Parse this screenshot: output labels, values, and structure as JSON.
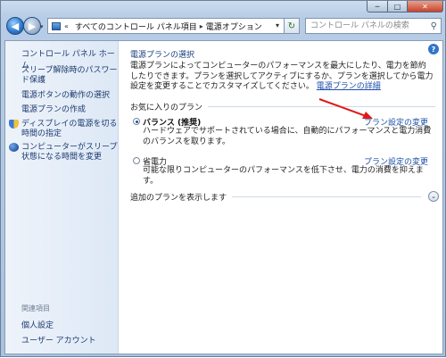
{
  "window": {
    "controls": {
      "minimize": "─",
      "maximize": "□",
      "close": "✕"
    }
  },
  "nav": {
    "back_glyph": "◀",
    "forward_glyph": "▶",
    "history_glyph": "▾",
    "address": {
      "overflow": "«",
      "segments": [
        "すべてのコントロール パネル項目",
        "電源オプション"
      ],
      "separator": "▸",
      "dropdown_glyph": "▾"
    },
    "refresh_glyph": "↻",
    "search_placeholder": "コントロール パネルの検索",
    "search_icon_glyph": "⚲"
  },
  "sidebar": {
    "home": "コントロール パネル ホーム",
    "links": [
      "スリープ解除時のパスワード保護",
      "電源ボタンの動作の選択",
      "電源プランの作成",
      "ディスプレイの電源を切る時間の指定",
      "コンピューターがスリープ状態になる時間を変更"
    ],
    "related_heading": "関連項目",
    "related_links": [
      "個人設定",
      "ユーザー アカウント"
    ]
  },
  "main": {
    "help_glyph": "?",
    "title": "電源プランの選択",
    "description": "電源プランによってコンピューターのパフォーマンスを最大にしたり、電力を節約したりできます。プランを選択してアクティブにするか、プランを選択してから電力設定を変更することでカスタマイズしてください。",
    "details_link": "電源プランの詳細",
    "favorites_heading": "お気に入りのプラン",
    "plans": [
      {
        "name": "バランス (推奨)",
        "selected": true,
        "description": "ハードウェアでサポートされている場合に、自動的にパフォーマンスと電力消費のバランスを取ります。",
        "change_link": "プラン設定の変更"
      },
      {
        "name": "省電力",
        "selected": false,
        "description": "可能な限りコンピューターのパフォーマンスを低下させ、電力の消費を抑えます。",
        "change_link": "プラン設定の変更"
      }
    ],
    "more_plans": "追加のプランを表示します",
    "more_plans_glyph": "⌄"
  },
  "colors": {
    "link": "#1c4ea8",
    "annotation_arrow": "#e01818",
    "sidebar_bg": "#dde8f6"
  }
}
